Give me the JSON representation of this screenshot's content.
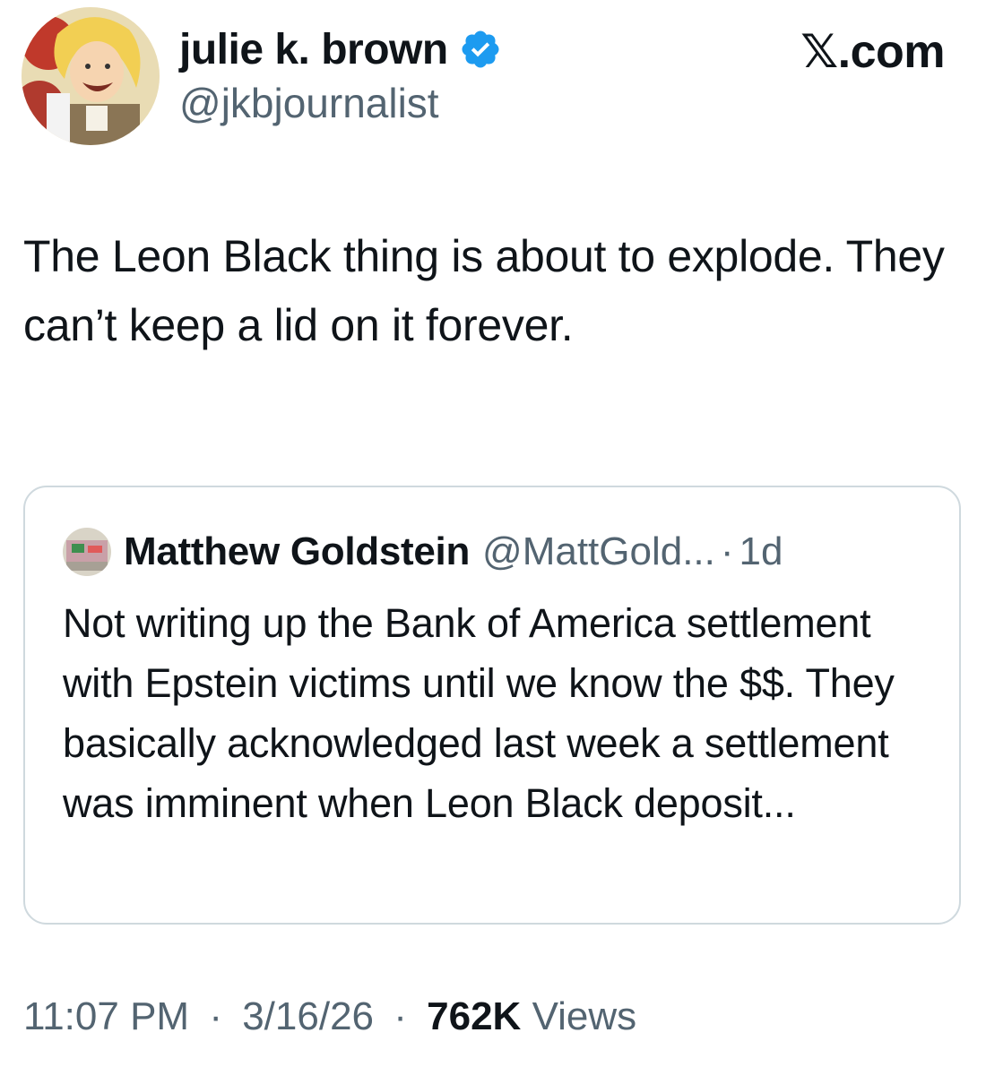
{
  "author": {
    "display_name": "julie k. brown",
    "handle": "@jkbjournalist",
    "verified_icon": "verified-badge-icon",
    "accent_color": "#1d9bf0"
  },
  "site_label": "𝕏.com",
  "tweet": {
    "text": "The Leon Black thing is about to explode. They can’t keep a lid on it forever."
  },
  "quoted_tweet": {
    "display_name": "Matthew Goldstein",
    "handle": "@MattGold...",
    "separator": "·",
    "age": "1d",
    "text": "Not writing up the Bank of America settlement with Epstein victims until we know the $$. They basically acknowledged last week a settlement was imminent when Leon Black deposit..."
  },
  "meta": {
    "time": "11:07 PM",
    "date": "3/16/26",
    "views_count": "762K",
    "views_label": "Views",
    "separator": "·"
  },
  "colors": {
    "text_primary": "#0f1419",
    "text_secondary": "#536471",
    "border": "#cfd9de"
  }
}
